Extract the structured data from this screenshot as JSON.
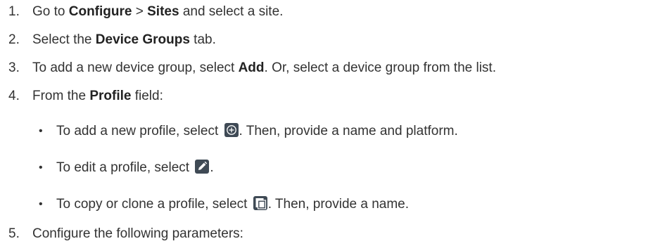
{
  "steps": [
    {
      "number": "1.",
      "t1": "Go to ",
      "b1": "Configure",
      "t2": " > ",
      "b2": "Sites",
      "t3": " and select a site."
    },
    {
      "number": "2.",
      "t1": "Select the ",
      "b1": "Device Groups",
      "t2": " tab."
    },
    {
      "number": "3.",
      "t1": "To add a new device group, select ",
      "b1": "Add",
      "t2": ". Or, select a device group from the list."
    },
    {
      "number": "4.",
      "t1": "From the ",
      "b1": "Profile",
      "t2": " field:"
    },
    {
      "number": "5.",
      "t1": "Configure the following parameters:"
    }
  ],
  "bullets": [
    {
      "before": "To add a new profile, select ",
      "icon": "add-circle-icon",
      "after": ". Then, provide a name and platform."
    },
    {
      "before": "To edit a profile, select ",
      "icon": "pencil-edit-icon",
      "after": "."
    },
    {
      "before": "To copy or clone a profile, select ",
      "icon": "copy-clone-icon",
      "after": ". Then, provide a name."
    }
  ],
  "bullet_symbol": "•",
  "colors": {
    "text": "#333333",
    "icon_fill": "#3f4a55"
  }
}
